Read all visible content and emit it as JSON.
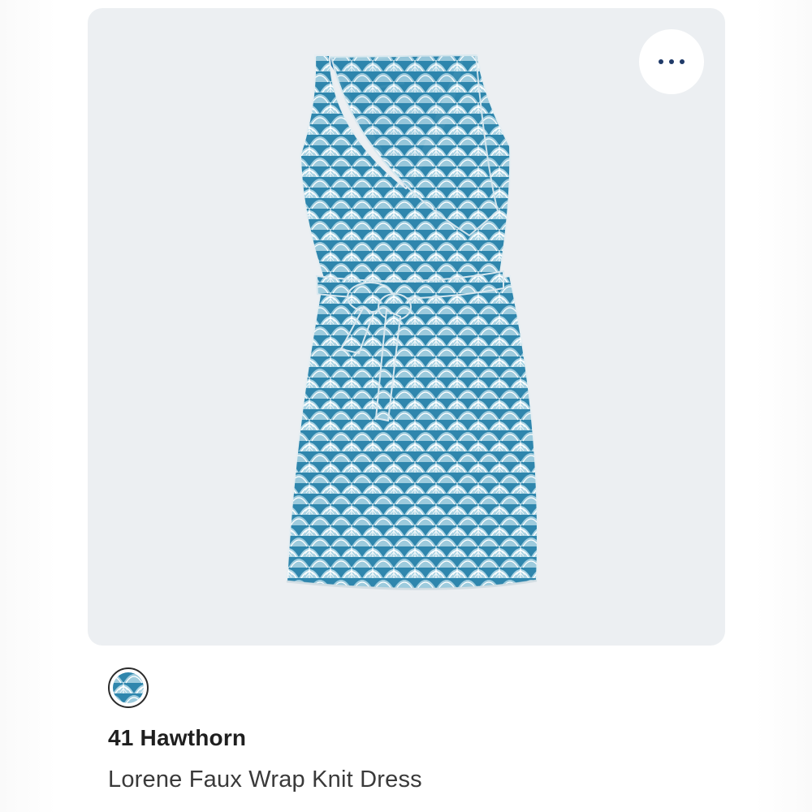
{
  "product_card": {
    "more_options_icon": "more-horizontal-icon",
    "image_alt": "dress-image",
    "swatch_icon": "pattern-swatch",
    "brand": "41 Hawthorn",
    "name": "Lorene Faux Wrap Knit Dress"
  },
  "colors": {
    "card_background": "#eceff2",
    "dress_primary": "#2b7ea7",
    "dress_light": "#8fc3d8",
    "dress_lining": "#1f78b0",
    "dots": "#1f3a68"
  }
}
